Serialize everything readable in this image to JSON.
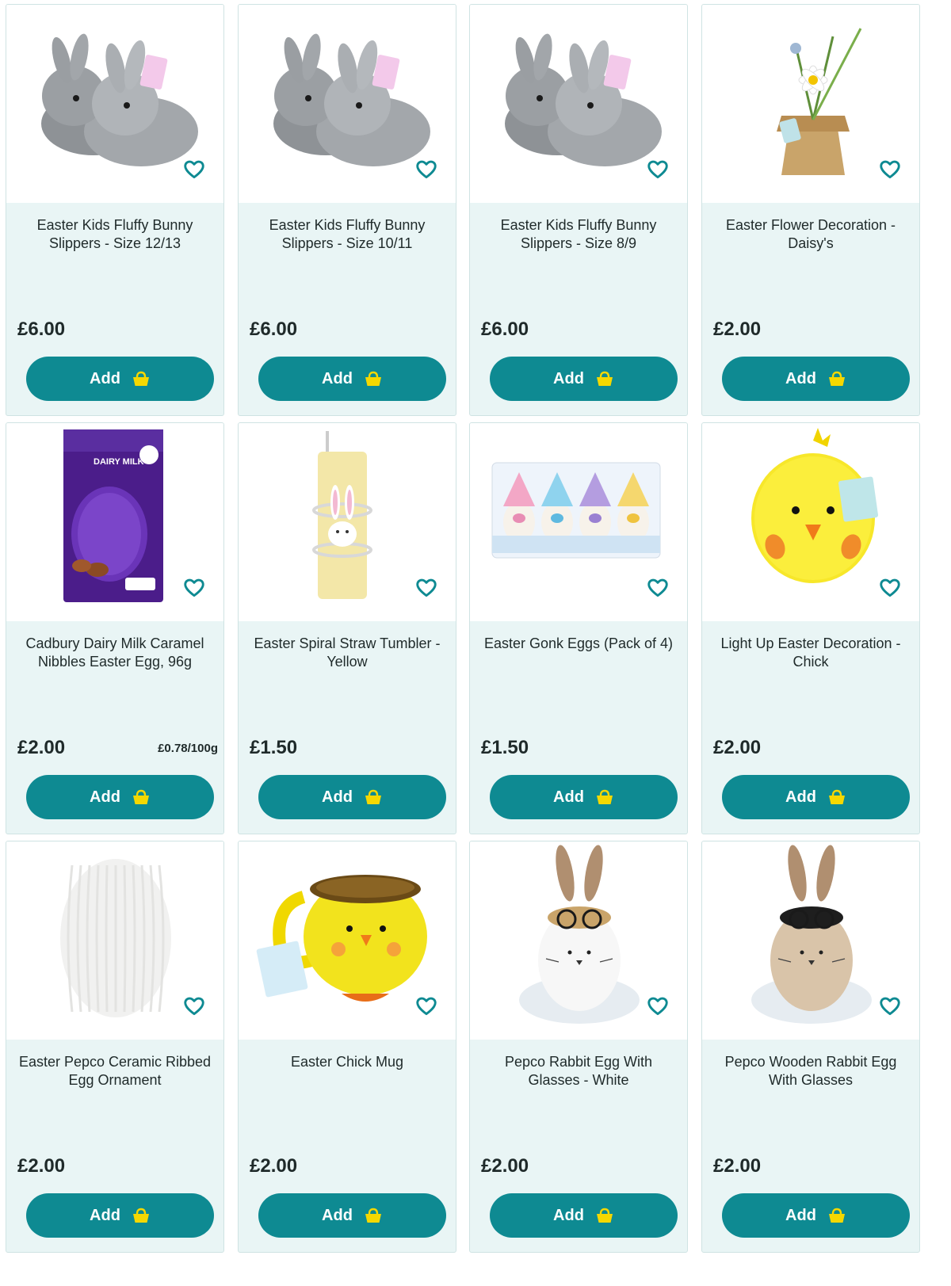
{
  "add_label": "Add",
  "colors": {
    "accent": "#0e8a92",
    "card_bg": "#e9f5f5",
    "basket": "#f5d800",
    "text": "#1f2a2a"
  },
  "products": [
    {
      "title": "Easter Kids Fluffy Bunny Slippers - Size 12/13",
      "price": "£6.00",
      "image": "grey-bunny-slippers"
    },
    {
      "title": "Easter Kids Fluffy Bunny Slippers - Size 10/11",
      "price": "£6.00",
      "image": "grey-bunny-slippers"
    },
    {
      "title": "Easter Kids Fluffy Bunny Slippers - Size 8/9",
      "price": "£6.00",
      "image": "grey-bunny-slippers"
    },
    {
      "title": "Easter Flower Decoration - Daisy's",
      "price": "£2.00",
      "image": "daisy-hessian-pot"
    },
    {
      "title": "Cadbury Dairy Milk Caramel Nibbles Easter Egg, 96g",
      "price": "£2.00",
      "unit_price": "£0.78/100g",
      "image": "purple-easter-egg-box",
      "box_text": "DAIRY MILK"
    },
    {
      "title": "Easter Spiral Straw Tumbler - Yellow",
      "price": "£1.50",
      "image": "yellow-bunny-tumbler"
    },
    {
      "title": "Easter Gonk Eggs (Pack of 4)",
      "price": "£1.50",
      "image": "gonk-eggs-tray"
    },
    {
      "title": "Light Up Easter Decoration - Chick",
      "price": "£2.00",
      "image": "yellow-light-up-chick"
    },
    {
      "title": "Easter Pepco Ceramic Ribbed Egg Ornament",
      "price": "£2.00",
      "image": "white-ribbed-egg"
    },
    {
      "title": "Easter Chick Mug",
      "price": "£2.00",
      "image": "yellow-chick-mug"
    },
    {
      "title": "Pepco Rabbit Egg With Glasses - White",
      "price": "£2.00",
      "image": "white-rabbit-egg-glasses"
    },
    {
      "title": "Pepco Wooden Rabbit Egg With Glasses",
      "price": "£2.00",
      "image": "wooden-rabbit-egg-glasses"
    }
  ]
}
